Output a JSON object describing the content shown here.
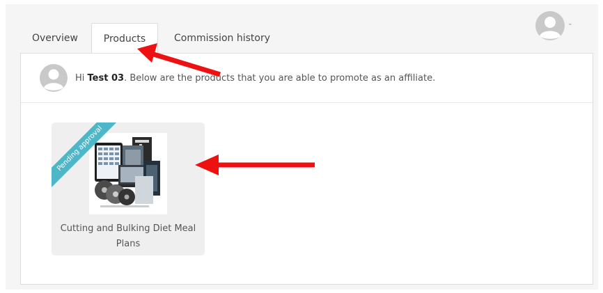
{
  "tabs": [
    {
      "label": "Overview",
      "active": false
    },
    {
      "label": "Products",
      "active": true
    },
    {
      "label": "Commission history",
      "active": false
    }
  ],
  "account": {
    "avatar_icon": "user-avatar-icon",
    "chevron_icon": "chevron-down-icon",
    "chevron_glyph": "⌄"
  },
  "welcome": {
    "greeting": "Hi ",
    "username": "Test 03",
    "message": ". Below are the products that you are able to promote as an affiliate."
  },
  "products": [
    {
      "title": "Cutting and Bulking Diet Meal Plans",
      "status_badge": "Pending approval"
    }
  ],
  "colors": {
    "ribbon": "#4db6c8",
    "annotation_arrow": "#ee1111",
    "panel_border": "#dddddd"
  }
}
